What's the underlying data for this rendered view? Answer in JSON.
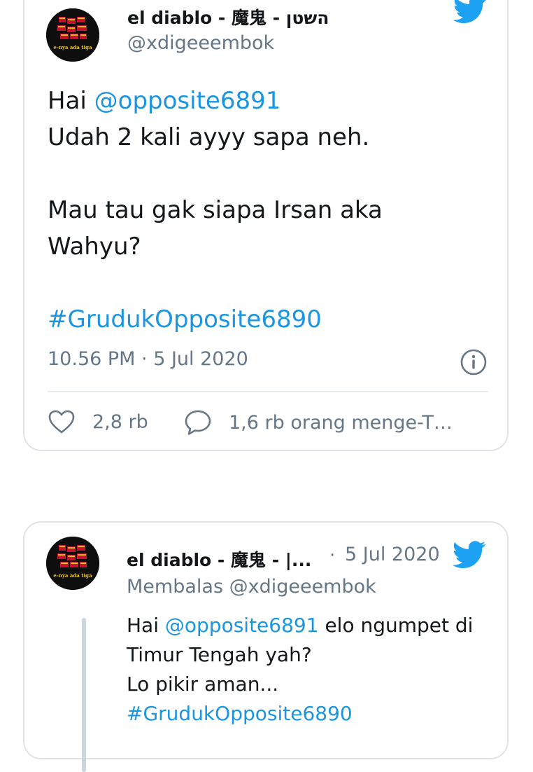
{
  "tweet": {
    "author_name": "el diablo - 魔鬼 - השטן",
    "author_handle": "@xdigeeembok",
    "avatar_caption": "e-nya ada tiga",
    "text_lines": [
      {
        "before": "Hai ",
        "mention": "@opposite6891"
      },
      {
        "plain": "Udah 2 kali ayyy sapa neh."
      },
      {
        "plain": "Mau tau gak siapa Irsan aka"
      },
      {
        "plain": "Wahyu?"
      }
    ],
    "hashtag": "#GrudukOpposite6890",
    "timestamp": "10.56 PM · 5 Jul 2020",
    "likes": "2,8 rb",
    "replies": "1,6 rb orang menge-T…"
  },
  "reply": {
    "author_name": "el diablo - 魔鬼 - |...",
    "separator": "·",
    "date": "5 Jul 2020",
    "reply_to": "Membalas @xdigeeembok",
    "avatar_caption": "e-nya ada tiga",
    "line1_before": "Hai ",
    "line1_mention": "@opposite6891",
    "line1_after": " elo ngumpet di",
    "line2": "Timur Tengah yah?",
    "line3": "Lo pikir aman...",
    "hashtag": "#GrudukOpposite6890"
  },
  "icons": {
    "bird": "twitter-bird-icon",
    "like": "heart-outline-icon",
    "reply": "speech-bubble-icon",
    "info": "info-circle-icon"
  },
  "colors": {
    "accent": "#1da1f2",
    "link": "#1b95e0",
    "muted": "#657786",
    "border": "#dfe3e7",
    "text": "#14171a"
  }
}
